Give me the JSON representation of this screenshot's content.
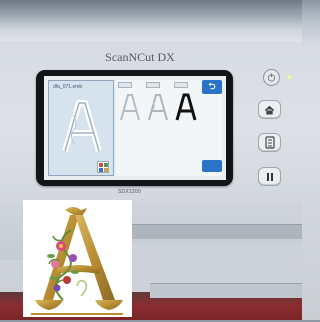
{
  "brand": "ScanNCut DX",
  "screen": {
    "file_name": "dfa_071.emb",
    "back_symbol": "⮌",
    "left_preview_letter": "A"
  },
  "model_label": "SDX1200",
  "controls": {
    "power_icon": "power-icon",
    "home_icon": "home-icon",
    "mat_icon": "mat-icon",
    "pause_icon": "pause-icon"
  },
  "inset": {
    "letter": "A"
  },
  "colors": {
    "lcd_blue": "#2b73c9",
    "gold": "#c9a44c",
    "red_strip": "#8d2c2f"
  }
}
